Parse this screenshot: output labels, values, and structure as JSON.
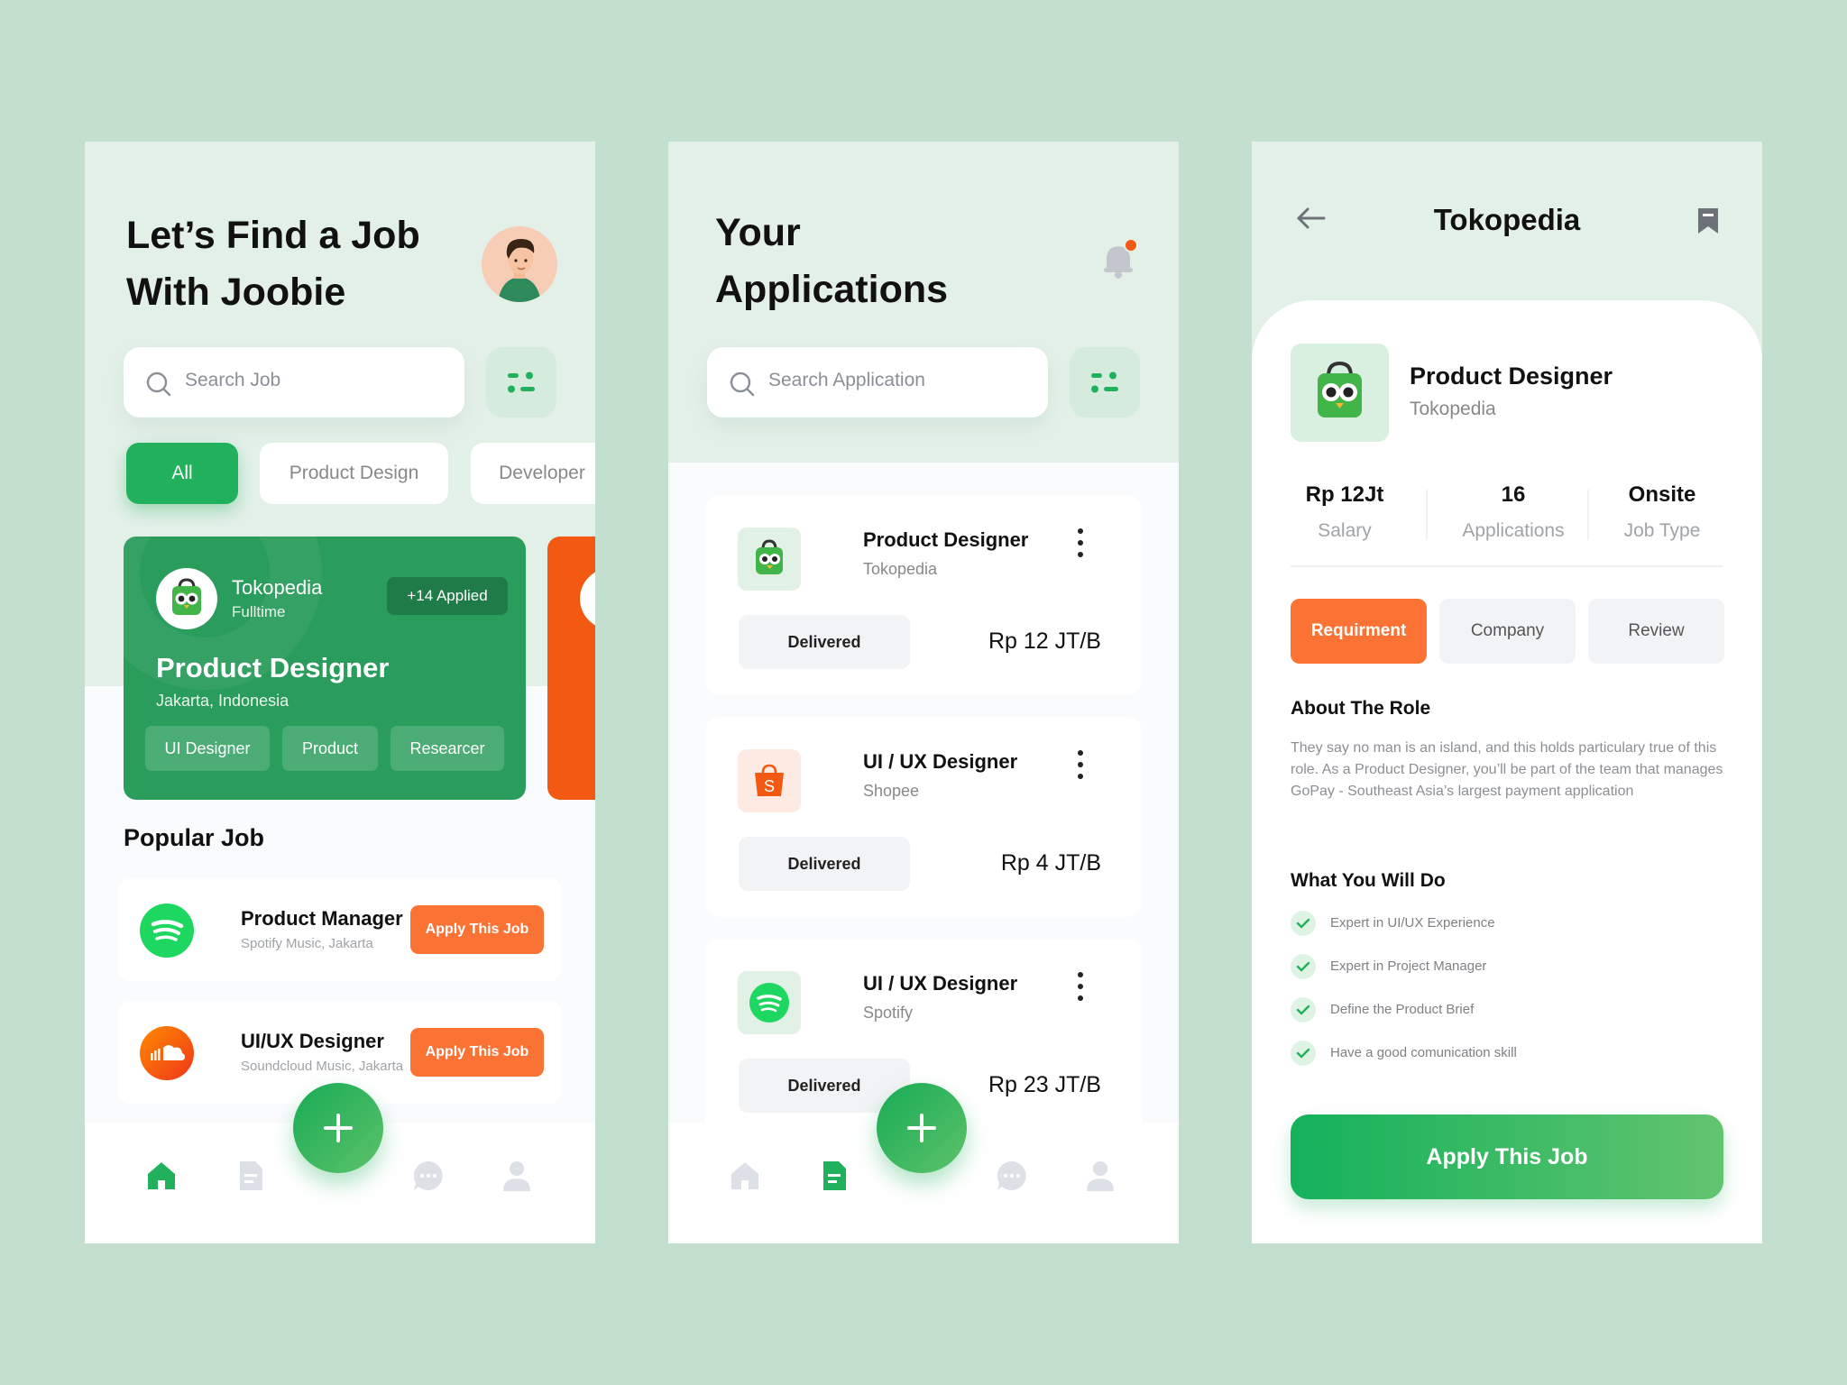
{
  "screen1": {
    "heading_line1": "Let’s Find a Job",
    "heading_line2": "With Joobie",
    "search_placeholder": "Search Job",
    "chips": [
      "All",
      "Product Design",
      "Developer"
    ],
    "featured": {
      "company": "Tokopedia",
      "type": "Fulltime",
      "badge": "+14 Applied",
      "title": "Product Designer",
      "location": "Jakarta, Indonesia",
      "tags": [
        "UI Designer",
        "Product",
        "Researcer"
      ]
    },
    "section_title": "Popular Job",
    "popular": [
      {
        "title": "Product Manager",
        "sub": "Spotify Music, Jakarta",
        "button": "Apply This Job"
      },
      {
        "title": "UI/UX Designer",
        "sub": "Soundcloud Music, Jakarta",
        "button": "Apply This Job"
      }
    ]
  },
  "screen2": {
    "heading_line1": "Your",
    "heading_line2": "Applications",
    "search_placeholder": "Search Application",
    "applications": [
      {
        "title": "Product Designer",
        "company": "Tokopedia",
        "status": "Delivered",
        "price": "Rp 12 JT/B"
      },
      {
        "title": "UI / UX Designer",
        "company": "Shopee",
        "status": "Delivered",
        "price": "Rp 4 JT/B"
      },
      {
        "title": "UI / UX Designer",
        "company": "Spotify",
        "status": "Delivered",
        "price": "Rp 23 JT/B"
      }
    ]
  },
  "screen3": {
    "title": "Tokopedia",
    "job_title": "Product Designer",
    "company": "Tokopedia",
    "stats": [
      {
        "value": "Rp 12Jt",
        "label": "Salary"
      },
      {
        "value": "16",
        "label": "Applications"
      },
      {
        "value": "Onsite",
        "label": "Job Type"
      }
    ],
    "tabs": [
      "Requirment",
      "Company",
      "Review"
    ],
    "about_title": "About The Role",
    "about_text": "They say no man is an island, and this holds particulary true of this role. As a Product Designer, you’ll be part of the team that manages GoPay - Southeast Asia’s largest payment application",
    "todo_title": "What You Will Do",
    "todo": [
      "Expert in UI/UX Experience",
      "Expert in Project Manager",
      "Define the Product Brief",
      "Have a good comunication skill"
    ],
    "apply_button": "Apply This Job"
  },
  "colors": {
    "background": "#c2e0cd",
    "primary_green": "#21b05b",
    "accent_orange": "#fb7334",
    "card_green": "#2a9c5c"
  },
  "icons": {
    "nav": [
      "home-icon",
      "document-icon",
      "chat-icon",
      "profile-icon"
    ]
  }
}
